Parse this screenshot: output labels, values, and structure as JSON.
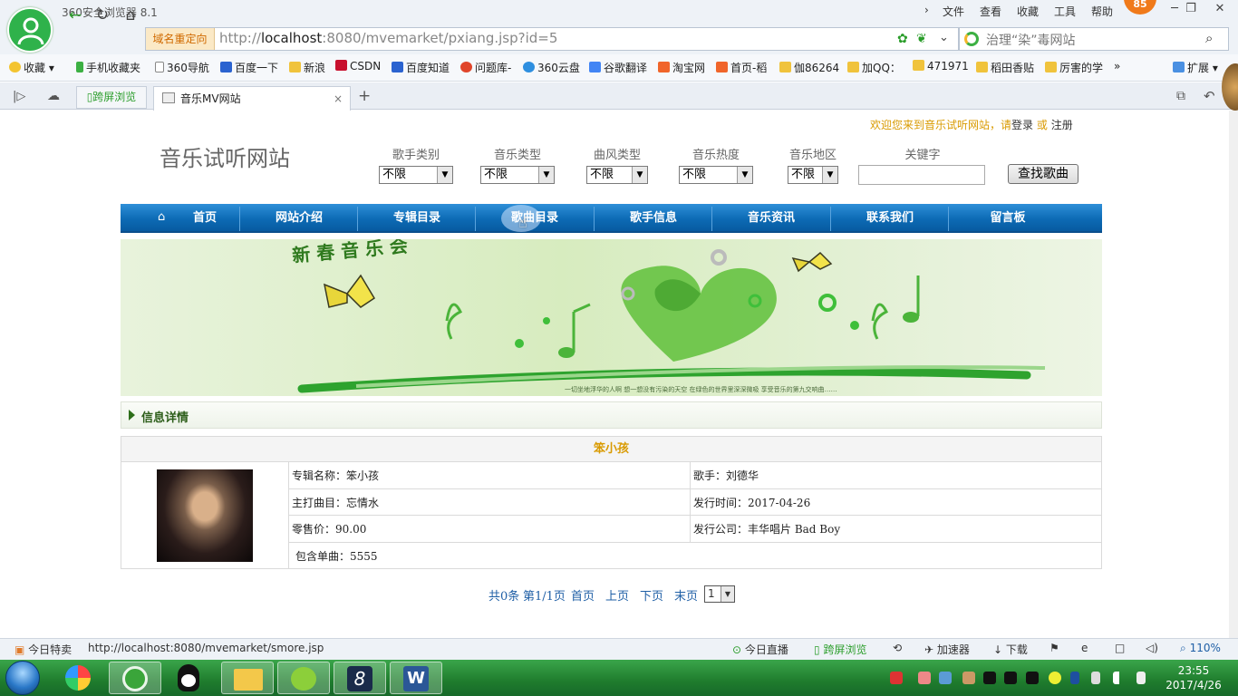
{
  "browser": {
    "window_title": "360安全浏览器 8.1",
    "menu": [
      "文件",
      "查看",
      "收藏",
      "工具",
      "帮助"
    ],
    "badge_count": "85",
    "redirect_tag": "域名重定向",
    "url_prefix": "http://",
    "url_host": "localhost",
    "url_rest": ":8080/mvemarket/pxiang.jsp?id=5",
    "search_text": "治理“染”毒网站",
    "bookmarks": [
      "收藏",
      "手机收藏夹",
      "360导航",
      "百度一下",
      "新浪",
      "CSDN",
      "百度知道",
      "问题库-",
      "360云盘",
      "谷歌翻译",
      "淘宝网",
      "首页-稻",
      "伽86264",
      "加QQ：",
      "471971",
      "稻田香贴",
      "厉害的学"
    ],
    "bookmarks_more": "扩展",
    "tab_split": "跨屏浏览",
    "tab_active": "音乐MV网站"
  },
  "site": {
    "welcome_prefix": "欢迎您来到音乐试听网站，请",
    "login": "登录",
    "or": "或",
    "register": "注册",
    "title": "音乐试听网站",
    "filters": [
      {
        "label": "歌手类别",
        "value": "不限"
      },
      {
        "label": "音乐类型",
        "value": "不限"
      },
      {
        "label": "曲风类型",
        "value": "不限"
      },
      {
        "label": "音乐热度",
        "value": "不限"
      },
      {
        "label": "音乐地区",
        "value": "不限"
      }
    ],
    "keyword_label": "关键字",
    "keyword_value": "",
    "search_button": "查找歌曲",
    "nav": [
      "首页",
      "网站介绍",
      "专辑目录",
      "歌曲目录",
      "歌手信息",
      "音乐资讯",
      "联系我们",
      "留言板"
    ],
    "banner_title": "新 春 音 乐 会",
    "banner_caption": "一切坐地浮华的人啊 想一想没有污染的天空 在绿色的世界里深深微吸 享受音乐的第九交响曲……",
    "info_header": "信息详情",
    "album": {
      "name_header": "笨小孩",
      "album_name_label": "专辑名称：",
      "album_name": "笨小孩",
      "singer_label": "歌手：",
      "singer": "刘德华",
      "main_song_label": "主打曲目：",
      "main_song": "忘情水",
      "release_label": "发行时间：",
      "release_date": "2017-04-26",
      "price_label": "零售价：",
      "price": "90.00",
      "publisher_label": "发行公司：",
      "publisher": "丰华唱片 Bad Boy",
      "singles_label": "包含单曲：",
      "singles": "5555"
    },
    "pager": {
      "total": "共0条",
      "page_of": "第1/1页",
      "first": "首页",
      "prev": "上页",
      "next": "下页",
      "last": "末页",
      "select_value": "1"
    }
  },
  "statusbar": {
    "left_label": "今日特卖",
    "url": "http://localhost:8080/mvemarket/smore.jsp",
    "live": "今日直播",
    "split": "跨屏浏览",
    "accelerator": "加速器",
    "download": "下载",
    "zoom": "110%"
  },
  "taskbar": {
    "time": "23:55",
    "date": "2017/4/26"
  }
}
